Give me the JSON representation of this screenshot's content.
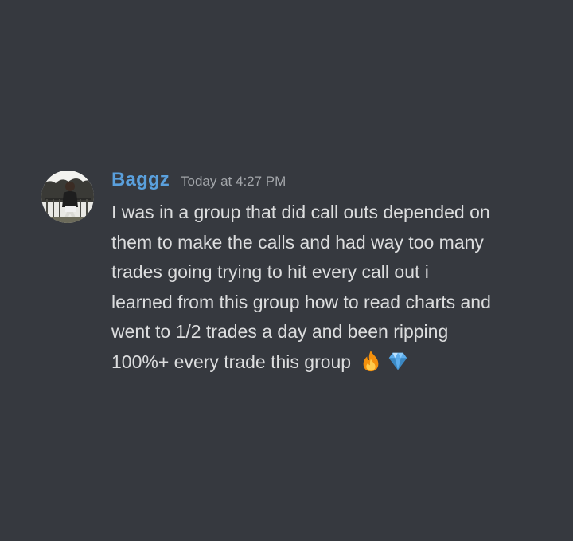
{
  "message": {
    "username": "Baggz",
    "timestamp": "Today at 4:27 PM",
    "lines": [
      "I was in a group that did call outs depended on",
      "them to make the calls and had way too many",
      "trades going trying to hit every call out i",
      "learned from this group how to read charts and",
      "went to 1/2 trades a day and been ripping",
      "100%+ every trade this group"
    ],
    "emojis": [
      "fire-emoji",
      "gem-emoji"
    ]
  },
  "colors": {
    "background": "#36393f",
    "username": "#5aa0dd",
    "timestamp": "#a3a6aa",
    "text": "#dcddde"
  }
}
